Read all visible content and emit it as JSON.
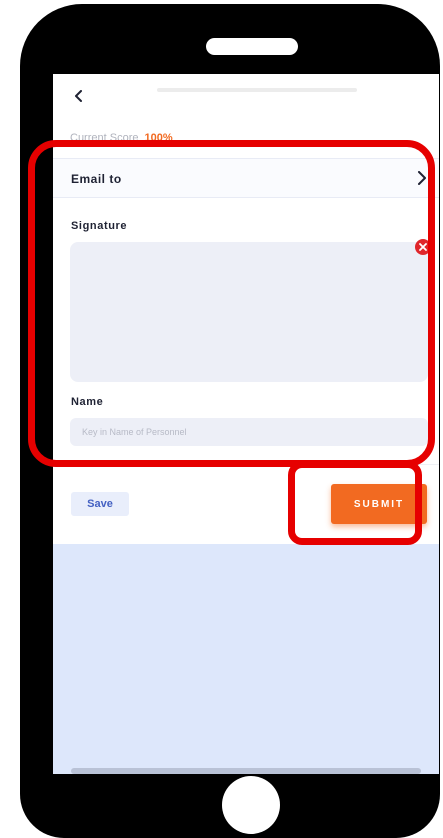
{
  "header": {
    "title": ""
  },
  "score": {
    "label": "Current Score",
    "value": "100%"
  },
  "email": {
    "label": "Email to"
  },
  "signature": {
    "label": "Signature"
  },
  "name": {
    "label": "Name",
    "placeholder": "Key in Name of Personnel",
    "value": ""
  },
  "actions": {
    "save_label": "Save",
    "submit_label": "SUBMIT"
  },
  "colors": {
    "accent": "#f26a21",
    "highlight": "#e60000",
    "save_text": "#4360c2",
    "clear_icon": "#e0262b",
    "lower_background": "#dde7fb"
  },
  "icons": {
    "back": "chevron-left-icon",
    "email_nav": "chevron-right-icon",
    "clear_signature": "close-icon"
  }
}
